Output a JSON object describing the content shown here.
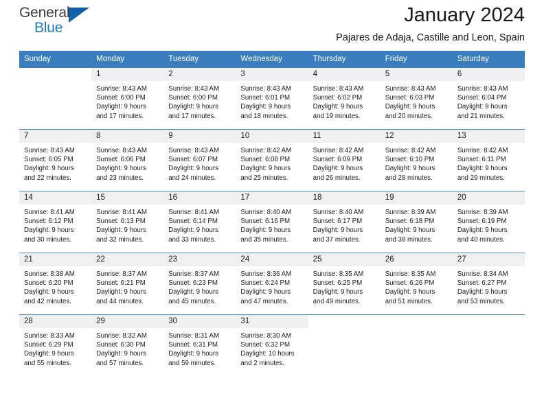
{
  "logo": {
    "word_one": "General",
    "word_two": "Blue",
    "triangle_color": "#1061a8",
    "blue_color": "#1f7ac0"
  },
  "header": {
    "title": "January 2024",
    "subtitle": "Pajares de Adaja, Castille and Leon, Spain"
  },
  "theme": {
    "header_bg": "#3a7ebf",
    "daynum_bg": "#f0f0f0",
    "row_divider": "#4a86c5"
  },
  "weekday_headers": [
    "Sunday",
    "Monday",
    "Tuesday",
    "Wednesday",
    "Thursday",
    "Friday",
    "Saturday"
  ],
  "weeks": [
    [
      {
        "day": "",
        "sunrise": "",
        "sunset": "",
        "daylight_1": "",
        "daylight_2": ""
      },
      {
        "day": "1",
        "sunrise": "Sunrise: 8:43 AM",
        "sunset": "Sunset: 6:00 PM",
        "daylight_1": "Daylight: 9 hours",
        "daylight_2": "and 17 minutes."
      },
      {
        "day": "2",
        "sunrise": "Sunrise: 8:43 AM",
        "sunset": "Sunset: 6:00 PM",
        "daylight_1": "Daylight: 9 hours",
        "daylight_2": "and 17 minutes."
      },
      {
        "day": "3",
        "sunrise": "Sunrise: 8:43 AM",
        "sunset": "Sunset: 6:01 PM",
        "daylight_1": "Daylight: 9 hours",
        "daylight_2": "and 18 minutes."
      },
      {
        "day": "4",
        "sunrise": "Sunrise: 8:43 AM",
        "sunset": "Sunset: 6:02 PM",
        "daylight_1": "Daylight: 9 hours",
        "daylight_2": "and 19 minutes."
      },
      {
        "day": "5",
        "sunrise": "Sunrise: 8:43 AM",
        "sunset": "Sunset: 6:03 PM",
        "daylight_1": "Daylight: 9 hours",
        "daylight_2": "and 20 minutes."
      },
      {
        "day": "6",
        "sunrise": "Sunrise: 8:43 AM",
        "sunset": "Sunset: 6:04 PM",
        "daylight_1": "Daylight: 9 hours",
        "daylight_2": "and 21 minutes."
      }
    ],
    [
      {
        "day": "7",
        "sunrise": "Sunrise: 8:43 AM",
        "sunset": "Sunset: 6:05 PM",
        "daylight_1": "Daylight: 9 hours",
        "daylight_2": "and 22 minutes."
      },
      {
        "day": "8",
        "sunrise": "Sunrise: 8:43 AM",
        "sunset": "Sunset: 6:06 PM",
        "daylight_1": "Daylight: 9 hours",
        "daylight_2": "and 23 minutes."
      },
      {
        "day": "9",
        "sunrise": "Sunrise: 8:43 AM",
        "sunset": "Sunset: 6:07 PM",
        "daylight_1": "Daylight: 9 hours",
        "daylight_2": "and 24 minutes."
      },
      {
        "day": "10",
        "sunrise": "Sunrise: 8:42 AM",
        "sunset": "Sunset: 6:08 PM",
        "daylight_1": "Daylight: 9 hours",
        "daylight_2": "and 25 minutes."
      },
      {
        "day": "11",
        "sunrise": "Sunrise: 8:42 AM",
        "sunset": "Sunset: 6:09 PM",
        "daylight_1": "Daylight: 9 hours",
        "daylight_2": "and 26 minutes."
      },
      {
        "day": "12",
        "sunrise": "Sunrise: 8:42 AM",
        "sunset": "Sunset: 6:10 PM",
        "daylight_1": "Daylight: 9 hours",
        "daylight_2": "and 28 minutes."
      },
      {
        "day": "13",
        "sunrise": "Sunrise: 8:42 AM",
        "sunset": "Sunset: 6:11 PM",
        "daylight_1": "Daylight: 9 hours",
        "daylight_2": "and 29 minutes."
      }
    ],
    [
      {
        "day": "14",
        "sunrise": "Sunrise: 8:41 AM",
        "sunset": "Sunset: 6:12 PM",
        "daylight_1": "Daylight: 9 hours",
        "daylight_2": "and 30 minutes."
      },
      {
        "day": "15",
        "sunrise": "Sunrise: 8:41 AM",
        "sunset": "Sunset: 6:13 PM",
        "daylight_1": "Daylight: 9 hours",
        "daylight_2": "and 32 minutes."
      },
      {
        "day": "16",
        "sunrise": "Sunrise: 8:41 AM",
        "sunset": "Sunset: 6:14 PM",
        "daylight_1": "Daylight: 9 hours",
        "daylight_2": "and 33 minutes."
      },
      {
        "day": "17",
        "sunrise": "Sunrise: 8:40 AM",
        "sunset": "Sunset: 6:16 PM",
        "daylight_1": "Daylight: 9 hours",
        "daylight_2": "and 35 minutes."
      },
      {
        "day": "18",
        "sunrise": "Sunrise: 8:40 AM",
        "sunset": "Sunset: 6:17 PM",
        "daylight_1": "Daylight: 9 hours",
        "daylight_2": "and 37 minutes."
      },
      {
        "day": "19",
        "sunrise": "Sunrise: 8:39 AM",
        "sunset": "Sunset: 6:18 PM",
        "daylight_1": "Daylight: 9 hours",
        "daylight_2": "and 38 minutes."
      },
      {
        "day": "20",
        "sunrise": "Sunrise: 8:39 AM",
        "sunset": "Sunset: 6:19 PM",
        "daylight_1": "Daylight: 9 hours",
        "daylight_2": "and 40 minutes."
      }
    ],
    [
      {
        "day": "21",
        "sunrise": "Sunrise: 8:38 AM",
        "sunset": "Sunset: 6:20 PM",
        "daylight_1": "Daylight: 9 hours",
        "daylight_2": "and 42 minutes."
      },
      {
        "day": "22",
        "sunrise": "Sunrise: 8:37 AM",
        "sunset": "Sunset: 6:21 PM",
        "daylight_1": "Daylight: 9 hours",
        "daylight_2": "and 44 minutes."
      },
      {
        "day": "23",
        "sunrise": "Sunrise: 8:37 AM",
        "sunset": "Sunset: 6:23 PM",
        "daylight_1": "Daylight: 9 hours",
        "daylight_2": "and 45 minutes."
      },
      {
        "day": "24",
        "sunrise": "Sunrise: 8:36 AM",
        "sunset": "Sunset: 6:24 PM",
        "daylight_1": "Daylight: 9 hours",
        "daylight_2": "and 47 minutes."
      },
      {
        "day": "25",
        "sunrise": "Sunrise: 8:35 AM",
        "sunset": "Sunset: 6:25 PM",
        "daylight_1": "Daylight: 9 hours",
        "daylight_2": "and 49 minutes."
      },
      {
        "day": "26",
        "sunrise": "Sunrise: 8:35 AM",
        "sunset": "Sunset: 6:26 PM",
        "daylight_1": "Daylight: 9 hours",
        "daylight_2": "and 51 minutes."
      },
      {
        "day": "27",
        "sunrise": "Sunrise: 8:34 AM",
        "sunset": "Sunset: 6:27 PM",
        "daylight_1": "Daylight: 9 hours",
        "daylight_2": "and 53 minutes."
      }
    ],
    [
      {
        "day": "28",
        "sunrise": "Sunrise: 8:33 AM",
        "sunset": "Sunset: 6:29 PM",
        "daylight_1": "Daylight: 9 hours",
        "daylight_2": "and 55 minutes."
      },
      {
        "day": "29",
        "sunrise": "Sunrise: 8:32 AM",
        "sunset": "Sunset: 6:30 PM",
        "daylight_1": "Daylight: 9 hours",
        "daylight_2": "and 57 minutes."
      },
      {
        "day": "30",
        "sunrise": "Sunrise: 8:31 AM",
        "sunset": "Sunset: 6:31 PM",
        "daylight_1": "Daylight: 9 hours",
        "daylight_2": "and 59 minutes."
      },
      {
        "day": "31",
        "sunrise": "Sunrise: 8:30 AM",
        "sunset": "Sunset: 6:32 PM",
        "daylight_1": "Daylight: 10 hours",
        "daylight_2": "and 2 minutes."
      },
      {
        "day": "",
        "sunrise": "",
        "sunset": "",
        "daylight_1": "",
        "daylight_2": ""
      },
      {
        "day": "",
        "sunrise": "",
        "sunset": "",
        "daylight_1": "",
        "daylight_2": ""
      },
      {
        "day": "",
        "sunrise": "",
        "sunset": "",
        "daylight_1": "",
        "daylight_2": ""
      }
    ]
  ]
}
